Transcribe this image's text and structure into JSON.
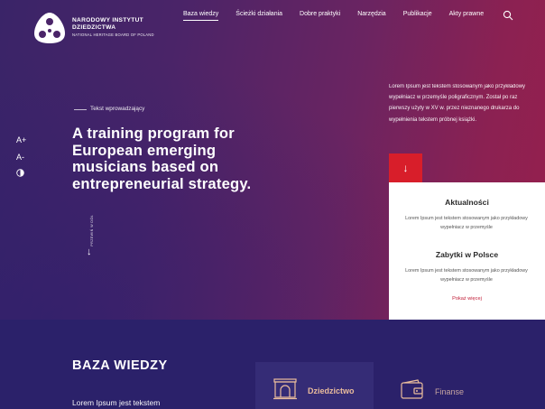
{
  "header": {
    "logo_line1": "NARODOWY INSTYTUT",
    "logo_line2": "DZIEDZICTWA",
    "logo_line3": "NATIONAL HERITAGE BOARD OF POLAND",
    "nav": [
      {
        "label": "Baza wiedzy",
        "active": true
      },
      {
        "label": "Ścieżki działania",
        "active": false
      },
      {
        "label": "Dobre praktyki",
        "active": false
      },
      {
        "label": "Narzędzia",
        "active": false
      },
      {
        "label": "Publikacje",
        "active": false
      },
      {
        "label": "Akty prawne",
        "active": false
      }
    ],
    "search_icon": "search-icon"
  },
  "hero": {
    "intro_label": "Tekst wprowadzający",
    "headline": "A training program for European emerging musicians based on entrepreneurial strategy.",
    "a11y": {
      "increase": "A+",
      "decrease": "A-",
      "contrast_icon": "contrast-icon"
    },
    "scroll_label": "PRZEWIŃ W DÓŁ",
    "side_text": "Lorem Ipsum jest tekstem stosowanym jako przykładowy wypełniacz w przemyśle poligraficznym. Został po raz pierwszy użyty w XV w. przez nieznanego drukarza do wypełnienia tekstem próbnej książki."
  },
  "news": {
    "arrow_icon": "arrow-down-icon",
    "items": [
      {
        "title": "Aktualności",
        "text": "Lorem Ipsum jest tekstem stosowanym jako przykładowy wypełniacz w przemyśle"
      },
      {
        "title": "Zabytki w Polsce",
        "text": "Lorem Ipsum jest tekstem stosowanym jako przykładowy wypełniacz w przemyśle"
      }
    ],
    "more_label": "Pokaż więcej"
  },
  "knowledge": {
    "title": "BAZA WIEDZY",
    "lorem": "Lorem Ipsum jest tekstem",
    "categories": [
      {
        "label": "Dziedzictwo",
        "icon": "arch-icon"
      },
      {
        "label": "Finanse",
        "icon": "wallet-icon"
      }
    ]
  },
  "colors": {
    "accent_red": "#d81e2a",
    "category_text": "#e9bc9c",
    "lower_bg": "#2b216a"
  }
}
